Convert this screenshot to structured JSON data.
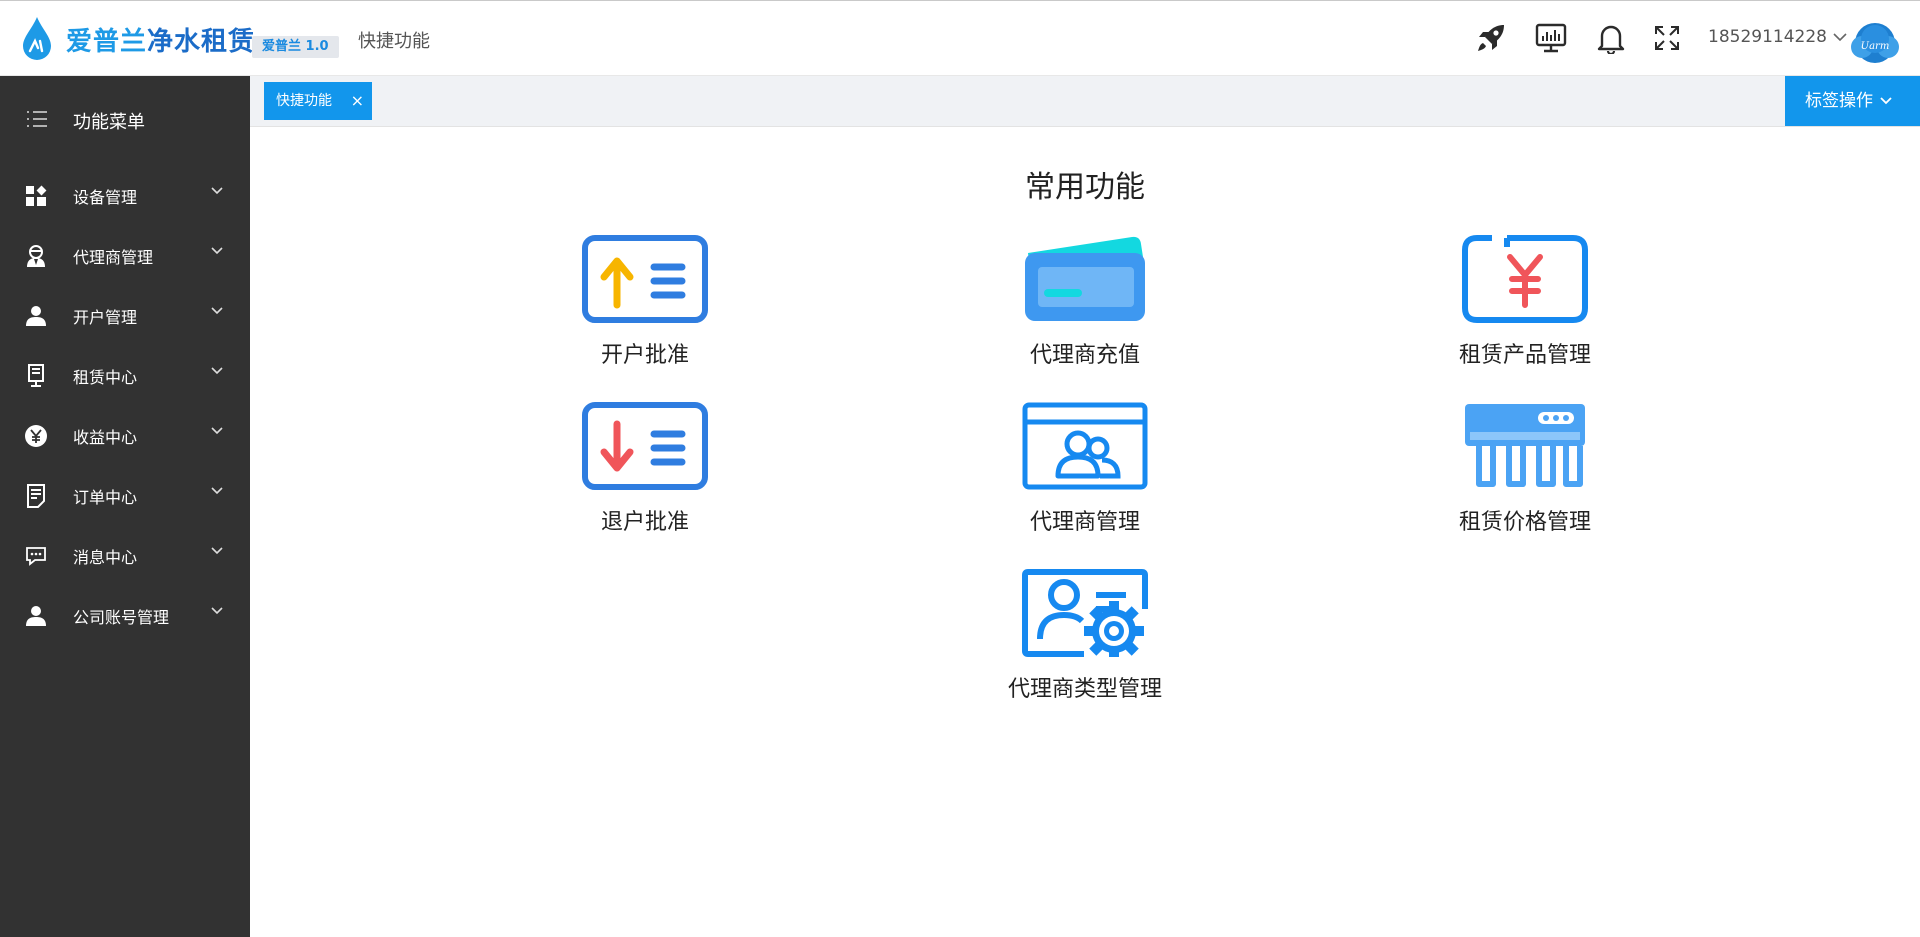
{
  "header": {
    "brand_part1": "爱普兰",
    "brand_part2": "净水租赁",
    "version": "爱普兰 1.0",
    "breadcrumb": "快捷功能",
    "username": "18529114228",
    "avatar_text": "Uarm"
  },
  "sidebar": {
    "menu_label": "功能菜单",
    "items": [
      {
        "label": "设备管理",
        "icon": "grid-icon"
      },
      {
        "label": "代理商管理",
        "icon": "agent-icon"
      },
      {
        "label": "开户管理",
        "icon": "user-icon"
      },
      {
        "label": "租赁中心",
        "icon": "rental-icon"
      },
      {
        "label": "收益中心",
        "icon": "yen-icon"
      },
      {
        "label": "订单中心",
        "icon": "order-icon"
      },
      {
        "label": "消息中心",
        "icon": "message-icon"
      },
      {
        "label": "公司账号管理",
        "icon": "account-icon"
      }
    ]
  },
  "tabs": {
    "active_label": "快捷功能",
    "close": "×",
    "tag_ops": "标签操作"
  },
  "main": {
    "title": "常用功能",
    "cards": [
      {
        "label": "开户批准",
        "icon": "account-approve-icon"
      },
      {
        "label": "代理商充值",
        "icon": "recharge-card-icon"
      },
      {
        "label": "租赁产品管理",
        "icon": "yen-product-icon"
      },
      {
        "label": "退户批准",
        "icon": "account-cancel-icon"
      },
      {
        "label": "代理商管理",
        "icon": "agent-manage-icon"
      },
      {
        "label": "租赁价格管理",
        "icon": "purifier-icon"
      },
      {
        "label": "代理商类型管理",
        "icon": "agent-type-icon"
      }
    ]
  },
  "colors": {
    "accent": "#1296ec",
    "sidebar_bg": "#323232",
    "icon_blue": "#2f80ed"
  }
}
